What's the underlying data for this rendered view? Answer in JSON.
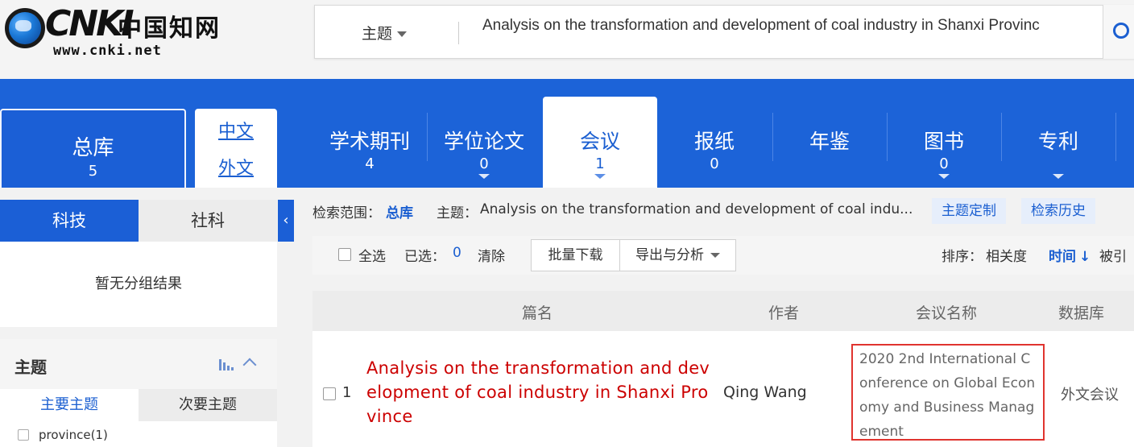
{
  "header": {
    "logo_brand": "CNKI",
    "logo_cn": "中国知网",
    "logo_url": "www.cnki.net",
    "search_field": "主题",
    "search_query": "Analysis on the transformation and development of coal industry in Shanxi Provinc"
  },
  "databases": {
    "total": {
      "label": "总库",
      "count": "5"
    },
    "lang": {
      "zh": "中文",
      "foreign": "外文"
    },
    "tabs": [
      {
        "label": "学术期刊",
        "count": "4"
      },
      {
        "label": "学位论文",
        "count": "0"
      },
      {
        "label": "会议",
        "count": "1"
      },
      {
        "label": "报纸",
        "count": "0"
      },
      {
        "label": "年鉴",
        "count": ""
      },
      {
        "label": "图书",
        "count": "0"
      },
      {
        "label": "专利",
        "count": ""
      }
    ],
    "active_tab": 2
  },
  "sidebar": {
    "tabs": [
      "科技",
      "社科"
    ],
    "collapse": "‹",
    "no_group": "暂无分组结果",
    "topic_title": "主题",
    "sub_tabs": [
      "主要主题",
      "次要主题"
    ],
    "facet_items": [
      "province(1)"
    ]
  },
  "scope": {
    "label": "检索范围：",
    "value": "总库",
    "topic_label": "主题：",
    "topic_value": "Analysis on the transformation and development of coal indu...",
    "custom_btn": "主题定制",
    "history_btn": "检索历史"
  },
  "toolbar": {
    "select_all": "全选",
    "selected_label": "已选：",
    "selected_count": "0",
    "clear": "清除",
    "batch_download": "批量下载",
    "export": "导出与分析",
    "sort_label": "排序：",
    "sort_relevance": "相关度",
    "sort_time": "时间",
    "sort_time_arrow": "↓",
    "sort_cited": "被引"
  },
  "table": {
    "columns": [
      "篇名",
      "作者",
      "会议名称",
      "数据库"
    ],
    "rows": [
      {
        "index": "1",
        "title": "Analysis on the transformation and development of coal industry in Shanxi Province",
        "author": "Qing Wang",
        "conference": "2020 2nd International Conference on Global Economy and Business Management",
        "database": "外文会议"
      }
    ]
  },
  "colors": {
    "brand_blue": "#1c63d8",
    "link_blue": "#1b5fd1",
    "title_red": "#cc0000",
    "highlight_border": "#e0342f"
  }
}
